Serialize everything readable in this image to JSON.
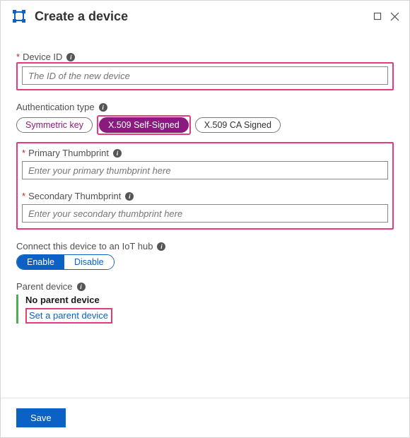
{
  "header": {
    "title": "Create a device"
  },
  "fields": {
    "device_id": {
      "label": "Device ID",
      "placeholder": "The ID of the new device"
    },
    "auth_type": {
      "label": "Authentication type",
      "opts": {
        "symmetric": "Symmetric key",
        "x509_self": "X.509 Self-Signed",
        "x509_ca": "X.509 CA Signed"
      }
    },
    "primary_thumb": {
      "label": "Primary Thumbprint",
      "placeholder": "Enter your primary thumbprint here"
    },
    "secondary_thumb": {
      "label": "Secondary Thumbprint",
      "placeholder": "Enter your secondary thumbprint here"
    },
    "connect_hub": {
      "label": "Connect this device to an IoT hub",
      "enable": "Enable",
      "disable": "Disable"
    },
    "parent_device": {
      "label": "Parent device",
      "none": "No parent device",
      "set_link": "Set a parent device"
    }
  },
  "footer": {
    "save": "Save"
  }
}
